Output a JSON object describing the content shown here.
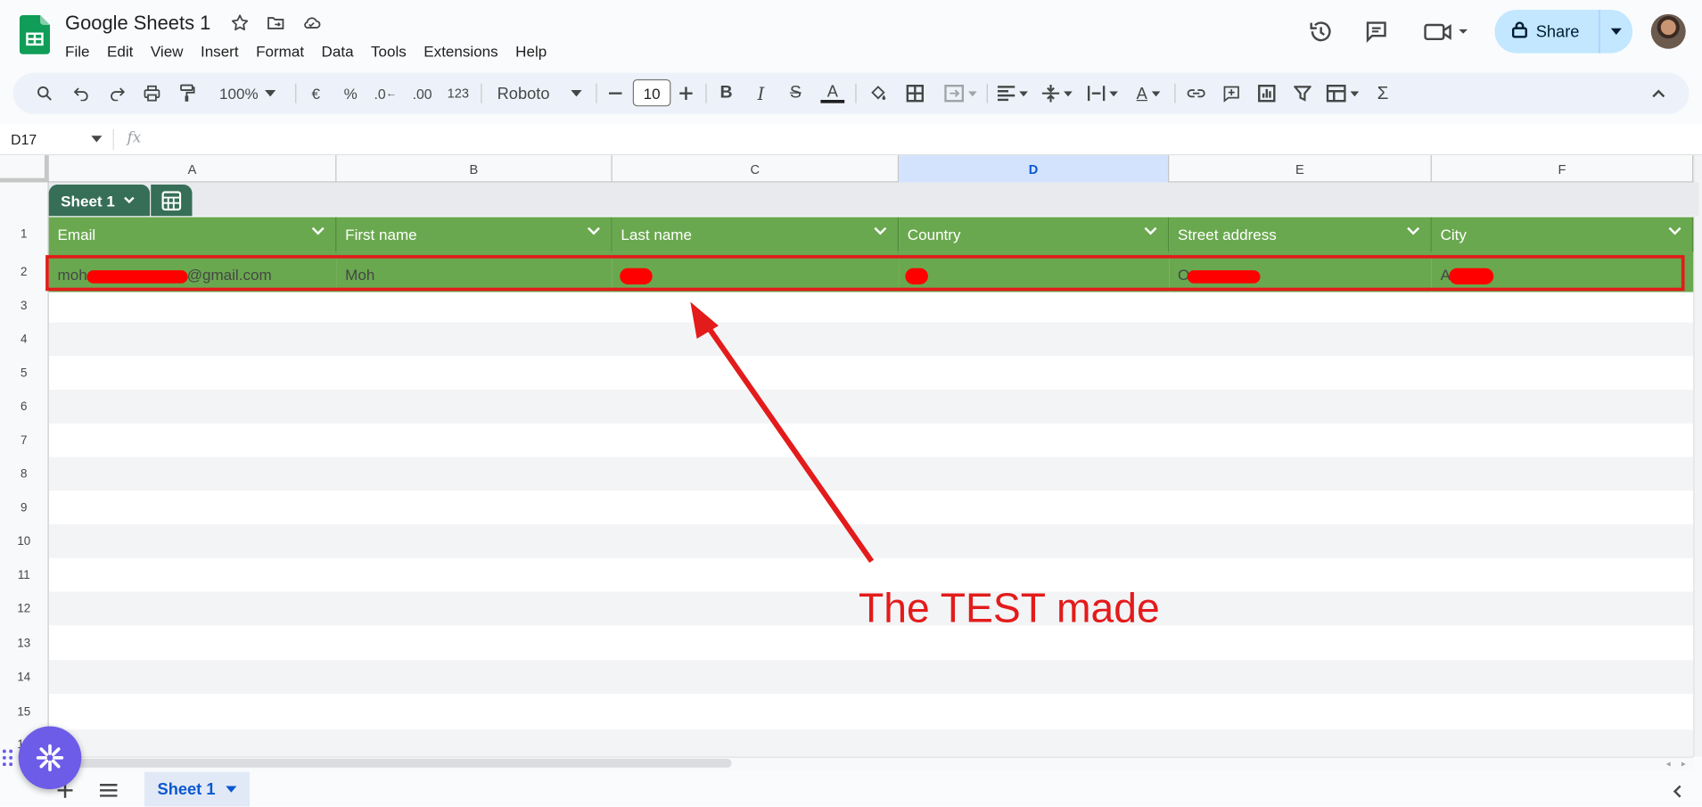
{
  "app": {
    "doc_title": "Google Sheets 1",
    "menu": [
      "File",
      "Edit",
      "View",
      "Insert",
      "Format",
      "Data",
      "Tools",
      "Extensions",
      "Help"
    ],
    "share_label": "Share",
    "accent_color": "#0b57d0",
    "header_fill": "#6aa84f"
  },
  "toolbar": {
    "zoom": "100%",
    "currency": "€",
    "percent": "%",
    "decrease_decimal": ".0",
    "increase_decimal": ".00",
    "number_format": "123",
    "font": "Roboto",
    "font_size": "10",
    "icons": [
      "search-icon",
      "undo-icon",
      "redo-icon",
      "print-icon",
      "paint-format-icon",
      "bold-icon",
      "italic-icon",
      "strikethrough-icon",
      "text-color-icon",
      "fill-color-icon",
      "borders-icon",
      "merge-icon",
      "align-icon",
      "valign-icon",
      "wrap-icon",
      "rotate-icon",
      "link-icon",
      "comment-icon",
      "chart-icon",
      "filter-icon",
      "table-view-icon",
      "functions-icon"
    ]
  },
  "formula_bar": {
    "name_box": "D17",
    "fx": "fx"
  },
  "grid": {
    "columns": [
      "A",
      "B",
      "C",
      "D",
      "E",
      "F"
    ],
    "selected_column": "D",
    "rows": [
      "1",
      "2",
      "3",
      "4",
      "5",
      "6",
      "7",
      "8",
      "9",
      "10",
      "11",
      "12",
      "13",
      "14",
      "15",
      "16"
    ],
    "table_name": "Sheet 1",
    "headers": [
      "Email",
      "First name",
      "Last name",
      "Country",
      "Street address",
      "City"
    ],
    "row2": {
      "email_prefix": "moh",
      "email_suffix": "@gmail.com",
      "first_name": "Moh",
      "street_prefix": "O",
      "city_prefix": "A"
    }
  },
  "annotation": {
    "text": "The TEST made",
    "color": "#e31b1b"
  },
  "bottom": {
    "sheet_tab": "Sheet 1"
  }
}
